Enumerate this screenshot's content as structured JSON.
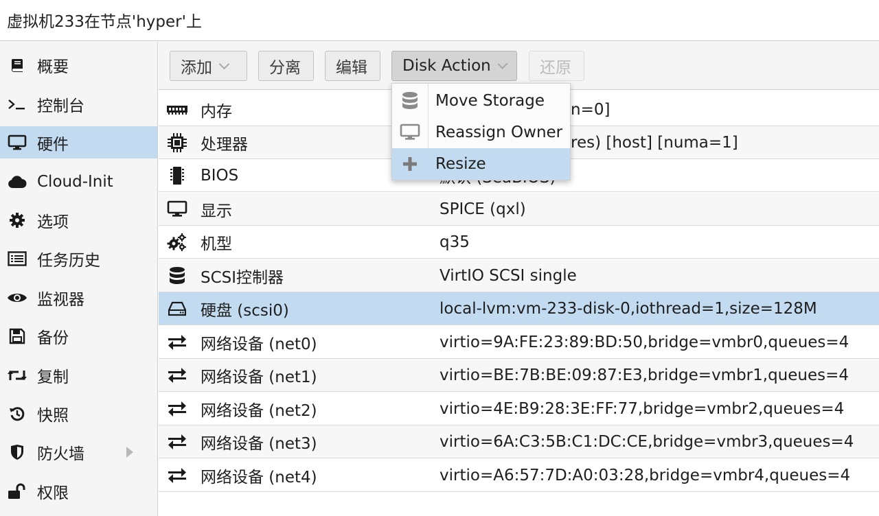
{
  "window": {
    "title": "虚拟机233在节点'hyper'上"
  },
  "sidebar": {
    "items": [
      {
        "label": "概要",
        "icon": "book-icon"
      },
      {
        "label": "控制台",
        "icon": "terminal-icon"
      },
      {
        "label": "硬件",
        "icon": "desktop-icon",
        "active": true
      },
      {
        "label": "Cloud-Init",
        "icon": "cloud-icon"
      },
      {
        "label": "选项",
        "icon": "gear-icon"
      },
      {
        "label": "任务历史",
        "icon": "list-icon"
      },
      {
        "label": "监视器",
        "icon": "eye-icon"
      },
      {
        "label": "备份",
        "icon": "floppy-icon"
      },
      {
        "label": "复制",
        "icon": "retweet-icon"
      },
      {
        "label": "快照",
        "icon": "history-icon"
      },
      {
        "label": "防火墙",
        "icon": "shield-icon",
        "has_submenu": true
      },
      {
        "label": "权限",
        "icon": "unlock-icon"
      }
    ]
  },
  "toolbar": {
    "add_label": "添加",
    "detach_label": "分离",
    "edit_label": "编辑",
    "disk_action_label": "Disk Action",
    "revert_label": "还原"
  },
  "disk_action_menu": {
    "items": [
      {
        "label": "Move Storage",
        "icon": "database-icon"
      },
      {
        "label": "Reassign Owner",
        "icon": "desktop-icon"
      },
      {
        "label": "Resize",
        "icon": "plus-icon",
        "highlighted": true
      }
    ]
  },
  "hardware": {
    "rows": [
      {
        "name": "内存",
        "value": "",
        "value_visible": "n=0]",
        "icon": "memory-icon"
      },
      {
        "name": "处理器",
        "value": "",
        "value_visible": "res) [host] [numa=1]",
        "icon": "cpu-icon"
      },
      {
        "name": "BIOS",
        "value": "",
        "value_visible": "默认 (SeaBIOS)",
        "icon": "microchip-icon"
      },
      {
        "name": "显示",
        "value": "SPICE (qxl)",
        "icon": "desktop-icon"
      },
      {
        "name": "机型",
        "value": "q35",
        "icon": "cogs-icon"
      },
      {
        "name": "SCSI控制器",
        "value": "VirtIO SCSI single",
        "icon": "database-icon"
      },
      {
        "name": "硬盘 (scsi0)",
        "value": "local-lvm:vm-233-disk-0,iothread=1,size=128M",
        "icon": "hdd-icon",
        "selected": true
      },
      {
        "name": "网络设备 (net0)",
        "value": "virtio=9A:FE:23:89:BD:50,bridge=vmbr0,queues=4",
        "icon": "exchange-icon"
      },
      {
        "name": "网络设备 (net1)",
        "value": "virtio=BE:7B:BE:09:87:E3,bridge=vmbr1,queues=4",
        "icon": "exchange-icon"
      },
      {
        "name": "网络设备 (net2)",
        "value": "virtio=4E:B9:28:3E:FF:77,bridge=vmbr2,queues=4",
        "icon": "exchange-icon"
      },
      {
        "name": "网络设备 (net3)",
        "value": "virtio=6A:C3:5B:C1:DC:CE,bridge=vmbr3,queues=4",
        "icon": "exchange-icon"
      },
      {
        "name": "网络设备 (net4)",
        "value": "virtio=A6:57:7D:A0:03:28,bridge=vmbr4,queues=4",
        "icon": "exchange-icon"
      }
    ]
  },
  "colors": {
    "selection": "#c3dbf0",
    "sidebar_bg": "#f5f5f5",
    "border": "#cfcfcf"
  }
}
